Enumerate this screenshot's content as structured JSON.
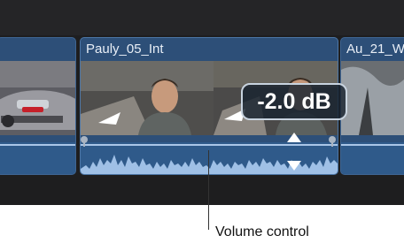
{
  "clips": {
    "main_title": "Pauly_05_Int",
    "right_title": "Au_21_W"
  },
  "volume": {
    "readout": "-2.0 dB"
  },
  "callout": {
    "label": "Volume control"
  },
  "colors": {
    "clip_blue": "#2d4f78",
    "audio_blue": "#2f5a8a",
    "waveform": "#9fc0e6",
    "timeline_bg": "#1e1e1f"
  }
}
